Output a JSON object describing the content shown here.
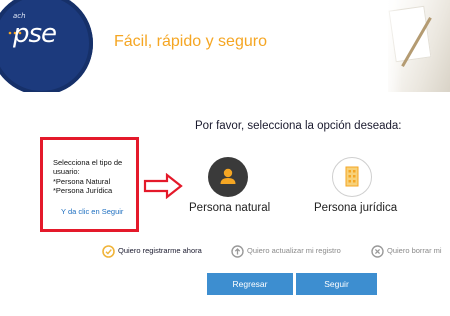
{
  "header": {
    "logo_prefix": "ach",
    "logo_text": "pse",
    "tagline": "Fácil, rápido y seguro"
  },
  "prompt": "Por favor, selecciona la opción deseada:",
  "hint": {
    "lines": [
      "Selecciona el tipo de",
      "usuario:",
      "*Persona Natural",
      "*Persona Jurídica"
    ],
    "link": "Y da clic en Seguir"
  },
  "options": [
    {
      "label": "Persona natural",
      "icon": "person-icon",
      "selected": true
    },
    {
      "label": "Persona jurídica",
      "icon": "building-icon",
      "selected": false
    }
  ],
  "status_options": [
    {
      "label": "Quiero registrarme ahora",
      "icon": "check-circle-icon",
      "active": true
    },
    {
      "label": "Quiero actualizar mi registro",
      "icon": "up-arrow-circle-icon",
      "active": false
    },
    {
      "label": "Quiero borrar mi",
      "icon": "x-circle-icon",
      "active": false
    }
  ],
  "buttons": {
    "back": "Regresar",
    "next": "Seguir"
  },
  "colors": {
    "accent_orange": "#f5a623",
    "button_blue": "#3d8ed0",
    "hint_red": "#e4192a",
    "link_blue": "#1e6fc0",
    "logo_navy": "#1c3a7d"
  }
}
